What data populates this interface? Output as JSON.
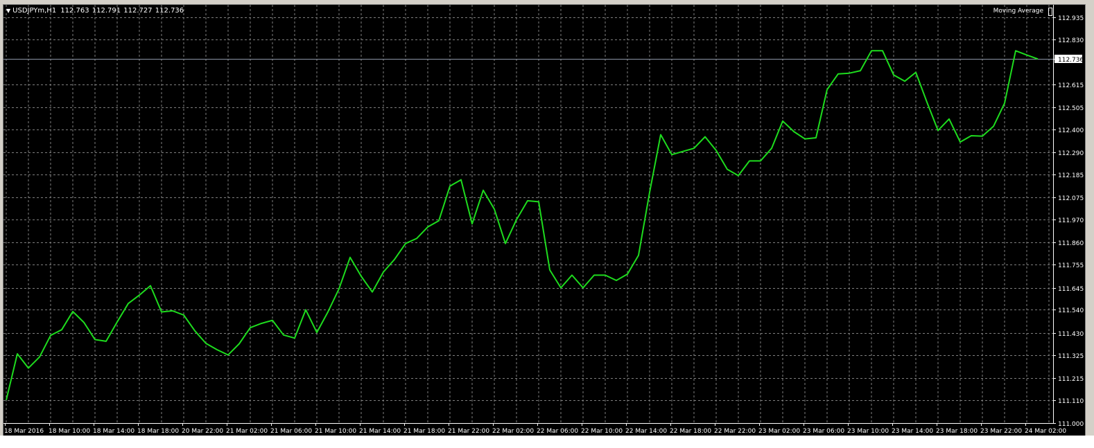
{
  "window": {
    "symbol": "USDJPYm,H1",
    "ohlc": "112.763 112.791 112.727 112.736",
    "indicator": "Moving Average"
  },
  "colors": {
    "background": "#000000",
    "grid": "#7f7f7f",
    "line": "#1edc1e",
    "axis_text": "#ffffff",
    "price_line": "#8c96a6"
  },
  "chart_data": {
    "type": "line",
    "title": "",
    "xlabel": "",
    "ylabel": "",
    "ylim": [
      111.0,
      112.994
    ],
    "yticks": [
      "112.935",
      "112.830",
      "112.736",
      "112.615",
      "112.505",
      "112.400",
      "112.290",
      "112.185",
      "112.075",
      "111.970",
      "111.860",
      "111.755",
      "111.645",
      "111.540",
      "111.430",
      "111.325",
      "111.215",
      "111.110",
      "111.000"
    ],
    "ytick_values": [
      112.935,
      112.83,
      112.736,
      112.615,
      112.505,
      112.4,
      112.29,
      112.185,
      112.075,
      111.97,
      111.86,
      111.755,
      111.645,
      111.54,
      111.43,
      111.325,
      111.215,
      111.11,
      111.0
    ],
    "current_price": 112.736,
    "xticks": [
      "18 Mar 2016",
      "18 Mar 10:00",
      "18 Mar 14:00",
      "18 Mar 18:00",
      "20 Mar 22:00",
      "21 Mar 02:00",
      "21 Mar 06:00",
      "21 Mar 10:00",
      "21 Mar 14:00",
      "21 Mar 18:00",
      "21 Mar 22:00",
      "22 Mar 02:00",
      "22 Mar 06:00",
      "22 Mar 10:00",
      "22 Mar 14:00",
      "22 Mar 18:00",
      "22 Mar 22:00",
      "23 Mar 02:00",
      "23 Mar 06:00",
      "23 Mar 10:00",
      "23 Mar 14:00",
      "23 Mar 18:00",
      "23 Mar 22:00",
      "24 Mar 02:00"
    ],
    "grid": true,
    "series": [
      {
        "values": [
          111.11,
          111.33,
          111.262,
          111.315,
          111.418,
          111.445,
          111.532,
          111.48,
          111.398,
          111.39,
          111.482,
          111.57,
          111.61,
          111.655,
          111.53,
          111.535,
          111.515,
          111.44,
          111.38,
          111.35,
          111.325,
          111.378,
          111.455,
          111.475,
          111.49,
          111.42,
          111.405,
          111.54,
          111.432,
          111.53,
          111.64,
          111.79,
          111.7,
          111.625,
          111.72,
          111.78,
          111.856,
          111.88,
          111.935,
          111.965,
          112.13,
          112.16,
          111.95,
          112.11,
          112.02,
          111.856,
          111.97,
          112.06,
          112.055,
          111.73,
          111.645,
          111.705,
          111.645,
          111.705,
          111.705,
          111.68,
          111.71,
          111.8,
          112.1,
          112.375,
          112.28,
          112.295,
          112.31,
          112.365,
          112.3,
          112.21,
          112.18,
          112.25,
          112.25,
          112.31,
          112.44,
          112.39,
          112.355,
          112.36,
          112.59,
          112.665,
          112.668,
          112.68,
          112.775,
          112.775,
          112.66,
          112.63,
          112.672,
          112.53,
          112.395,
          112.45,
          112.34,
          112.37,
          112.368,
          112.415,
          112.525,
          112.775,
          112.755,
          112.736
        ]
      }
    ]
  }
}
